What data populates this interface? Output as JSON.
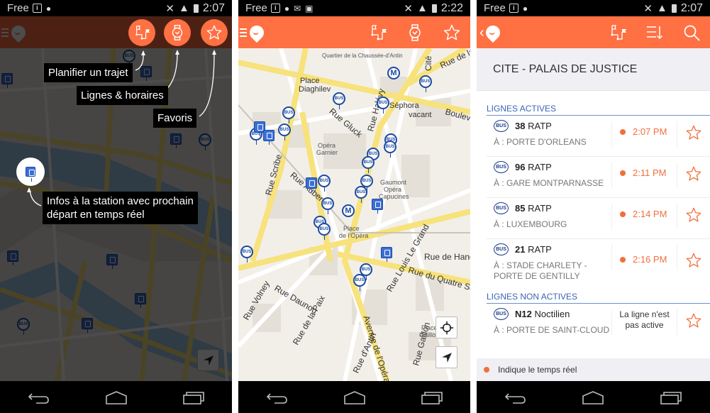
{
  "colors": {
    "accent": "#ff7043",
    "realtime": "#f0703c",
    "link_blue": "#3a64b8",
    "bus_blue": "#1c4aa0"
  },
  "screens": [
    {
      "status": {
        "carrier": "Free",
        "time": "2:07"
      },
      "toolbar_icons": [
        "route-planner-icon",
        "watch-schedule-icon",
        "star-favorites-icon"
      ],
      "tooltips": {
        "plan": "Planifier un trajet",
        "lines": "Lignes & horaires",
        "favorites": "Favoris",
        "station_info_line1": "Infos à la station avec prochain",
        "station_info_line2": "départ en temps réel"
      }
    },
    {
      "status": {
        "carrier": "Free",
        "time": "2:22"
      },
      "toolbar_icons": [
        "route-planner-icon",
        "watch-schedule-icon",
        "star-favorites-icon"
      ],
      "map_labels": {
        "quartier": "Quartier de la Chaussée-d'Antin",
        "place_diaghilev_1": "Place",
        "place_diaghilev_2": "Diaghilev",
        "rue_gluck": "Rue Gluck",
        "rue_halevy": "Rue Halévy",
        "sephora": "Séphora",
        "vacant": "vacant",
        "opera_garnier_1": "Opéra",
        "opera_garnier_2": "Garnier",
        "rue_scribe": "Rue Scribe",
        "rue_auber": "Rue Auber",
        "gaumont_1": "Gaumont",
        "gaumont_2": "Opéra",
        "gaumont_3": "Capucines",
        "place_opera_1": "Place",
        "place_opera_2": "de l'Opéra",
        "rue_hanovre": "Rue de Hanovre",
        "rue_quatre_sept": "Rue du Quatre Septembre",
        "rue_louis_le_grand": "Rue Louis Le Grand",
        "rue_daunou": "Rue Daunou",
        "rue_volney": "Rue Volney",
        "rue_paix": "Rue de la Paix",
        "avenue_opera": "Avenue de l'Opéra",
        "rue_antin": "Rue d'Antin",
        "rue_gaillon": "Rue Gaillon",
        "place_gaillon_1": "Place",
        "place_gaillon_2": "Gaillon",
        "boulevard": "Boulevard",
        "rue_de_la": "Rue de la",
        "cite": "Cité",
        "bus": "BUS",
        "metro": "M"
      }
    },
    {
      "status": {
        "carrier": "Free",
        "time": "2:07"
      },
      "toolbar_icons": [
        "route-planner-icon",
        "sort-icon",
        "search-icon"
      ],
      "station_name": "CITE - PALAIS DE JUSTICE",
      "active_title": "LIGNES ACTIVES",
      "inactive_title": "LIGNES NON ACTIVES",
      "badge": "BUS",
      "active_lines": [
        {
          "number": "38",
          "operator": "RATP",
          "dest": "À : PORTE D'ORLEANS",
          "time": "2:07 PM"
        },
        {
          "number": "96",
          "operator": "RATP",
          "dest": "À : GARE MONTPARNASSE",
          "time": "2:11 PM"
        },
        {
          "number": "85",
          "operator": "RATP",
          "dest": "À : LUXEMBOURG",
          "time": "2:14 PM"
        },
        {
          "number": "21",
          "operator": "RATP",
          "dest": "À : STADE CHARLETY - PORTE DE GENTILLY",
          "time": "2:16 PM"
        }
      ],
      "inactive_lines": [
        {
          "number": "N12",
          "operator": "Noctilien",
          "dest": "À : PORTE DE SAINT-CLOUD",
          "status": "La ligne n'est pas active"
        }
      ],
      "legend": "Indique le temps réel"
    }
  ]
}
